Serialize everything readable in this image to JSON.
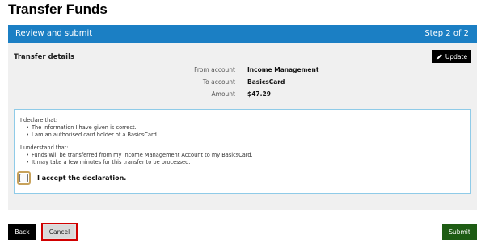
{
  "page": {
    "title": "Transfer Funds"
  },
  "panel": {
    "header_left": "Review and submit",
    "header_right": "Step 2 of 2",
    "details_heading": "Transfer details",
    "update_label": "Update",
    "details": [
      {
        "label": "From account",
        "value": "Income Management"
      },
      {
        "label": "To account",
        "value": "BasicsCard"
      },
      {
        "label": "Amount",
        "value": "$47.29"
      }
    ]
  },
  "declaration": {
    "declare_intro": "I declare that:",
    "declare_points": [
      "The information I have given is correct.",
      "I am an authorised card holder of a BasicsCard."
    ],
    "understand_intro": "I understand that:",
    "understand_points": [
      "Funds will be transferred from my Income Management Account to my BasicsCard.",
      "It may take a few minutes for this transfer to be processed."
    ],
    "accept_label": "I accept the declaration.",
    "accepted": false
  },
  "actions": {
    "back_label": "Back",
    "cancel_label": "Cancel",
    "submit_label": "Submit"
  },
  "colors": {
    "header_blue": "#1b7fc4",
    "submit_green": "#1e5c14",
    "cancel_highlight": "#d10000"
  }
}
